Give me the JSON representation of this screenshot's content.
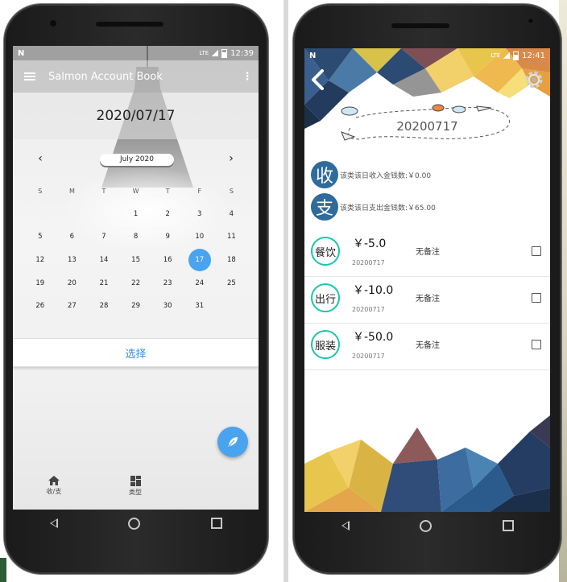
{
  "left_phone": {
    "status": {
      "time": "12:39",
      "lte": "LTE"
    },
    "appbar": {
      "title": "Salmon Account Book"
    },
    "selected_date": "2020/07/17",
    "calendar": {
      "month_label": "July 2020",
      "prev": "‹",
      "next": "›",
      "weekdays": [
        "S",
        "M",
        "T",
        "W",
        "T",
        "F",
        "S"
      ],
      "weeks": [
        [
          "",
          "",
          "",
          "1",
          "2",
          "3",
          "4"
        ],
        [
          "5",
          "6",
          "7",
          "8",
          "9",
          "10",
          "11"
        ],
        [
          "12",
          "13",
          "14",
          "15",
          "16",
          "17",
          "18"
        ],
        [
          "19",
          "20",
          "21",
          "22",
          "23",
          "24",
          "25"
        ],
        [
          "26",
          "27",
          "28",
          "29",
          "30",
          "31",
          ""
        ]
      ],
      "selected_day": "17"
    },
    "select_button": "选择",
    "bottom_nav": [
      {
        "label": "收/支",
        "icon": "home-icon"
      },
      {
        "label": "类型",
        "icon": "dashboard-icon"
      }
    ],
    "fab_icon": "feather-icon"
  },
  "right_phone": {
    "status": {
      "time": "12:41",
      "lte": "LTE"
    },
    "day_title": "20200717",
    "income": {
      "badge": "收",
      "text": "该类该日收入金钱数:￥0.00"
    },
    "expense": {
      "badge": "支",
      "text": "该类该日支出金钱数:￥65.00"
    },
    "records": [
      {
        "category": "餐饮",
        "amount": "￥-5.0",
        "date": "20200717",
        "note": "无备注"
      },
      {
        "category": "出行",
        "amount": "￥-10.0",
        "date": "20200717",
        "note": "无备注"
      },
      {
        "category": "服装",
        "amount": "￥-50.0",
        "date": "20200717",
        "note": "无备注"
      }
    ],
    "icons": {
      "back": "back-chevron-icon",
      "settings": "gear-icon"
    }
  }
}
